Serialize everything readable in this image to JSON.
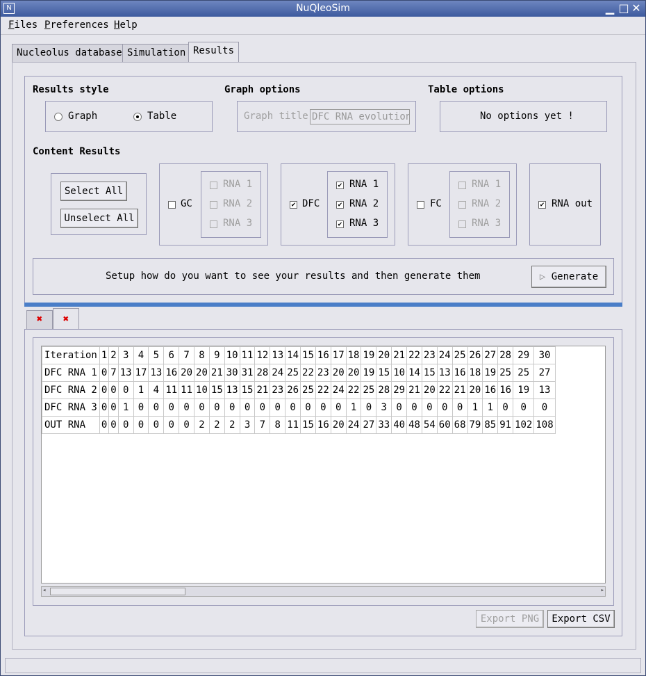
{
  "window": {
    "title": "NuQleoSim"
  },
  "menu": [
    "Files",
    "Preferences",
    "Help"
  ],
  "tabs": [
    "Nucleolus database",
    "Simulation",
    "Results"
  ],
  "results_style": {
    "heading": "Results style",
    "graph_label": "Graph",
    "table_label": "Table",
    "selected": "Table"
  },
  "graph_options": {
    "heading": "Graph options",
    "title_label": "Graph title",
    "title_value": "DFC RNA evolution"
  },
  "table_options": {
    "heading": "Table options",
    "message": "No options yet !"
  },
  "content_results": {
    "heading": "Content Results",
    "select_all": "Select All",
    "unselect_all": "Unselect All",
    "gc": {
      "label": "GC",
      "checked": false,
      "rna": [
        "RNA 1",
        "RNA 2",
        "RNA 3"
      ]
    },
    "dfc": {
      "label": "DFC",
      "checked": true,
      "rna": [
        "RNA 1",
        "RNA 2",
        "RNA 3"
      ]
    },
    "fc": {
      "label": "FC",
      "checked": false,
      "rna": [
        "RNA 1",
        "RNA 2",
        "RNA 3"
      ]
    },
    "rna_out": {
      "label": "RNA out",
      "checked": true
    }
  },
  "generate": {
    "message": "Setup how do you want to see your results and then generate them",
    "button": "Generate"
  },
  "result_tabs": [
    "close-tab-1",
    "close-tab-2"
  ],
  "table": {
    "header": [
      "Iteration",
      "1",
      "2",
      "3",
      "4",
      "5",
      "6",
      "7",
      "8",
      "9",
      "10",
      "11",
      "12",
      "13",
      "14",
      "15",
      "16",
      "17",
      "18",
      "19",
      "20",
      "21",
      "22",
      "23",
      "24",
      "25",
      "26",
      "27",
      "28",
      "29",
      "30"
    ],
    "rows": [
      [
        "DFC RNA 1",
        "0",
        "7",
        "13",
        "17",
        "13",
        "16",
        "20",
        "20",
        "21",
        "30",
        "31",
        "28",
        "24",
        "25",
        "22",
        "23",
        "20",
        "20",
        "19",
        "15",
        "10",
        "14",
        "15",
        "13",
        "16",
        "18",
        "19",
        "25",
        "25",
        "27"
      ],
      [
        "DFC RNA 2",
        "0",
        "0",
        "0",
        "1",
        "4",
        "11",
        "11",
        "10",
        "15",
        "13",
        "15",
        "21",
        "23",
        "26",
        "25",
        "22",
        "24",
        "22",
        "25",
        "28",
        "29",
        "21",
        "20",
        "22",
        "21",
        "20",
        "16",
        "16",
        "19",
        "13"
      ],
      [
        "DFC RNA 3",
        "0",
        "0",
        "1",
        "0",
        "0",
        "0",
        "0",
        "0",
        "0",
        "0",
        "0",
        "0",
        "0",
        "0",
        "0",
        "0",
        "0",
        "1",
        "0",
        "3",
        "0",
        "0",
        "0",
        "0",
        "0",
        "1",
        "1",
        "0",
        "0",
        "0"
      ],
      [
        "OUT RNA",
        "0",
        "0",
        "0",
        "0",
        "0",
        "0",
        "0",
        "2",
        "2",
        "2",
        "3",
        "7",
        "8",
        "11",
        "15",
        "16",
        "20",
        "24",
        "27",
        "33",
        "40",
        "48",
        "54",
        "60",
        "68",
        "79",
        "85",
        "91",
        "102",
        "108"
      ]
    ]
  },
  "export": {
    "png": "Export PNG",
    "csv": "Export CSV"
  }
}
